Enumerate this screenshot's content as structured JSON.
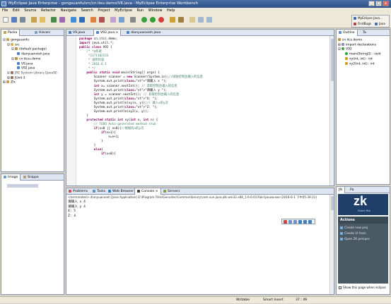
{
  "window": {
    "title": "MyEclipse Java Enterprise - gongsuanfu/src/cn.lieu.demo/V8.java - MyEclipse Enterprise Workbench"
  },
  "menu": [
    "File",
    "Edit",
    "Source",
    "Refactor",
    "Navigate",
    "Search",
    "Project",
    "MyEclipse",
    "Run",
    "Window",
    "Help"
  ],
  "perspectives": {
    "myeclipse": "MyEclipse Java...",
    "pindbugs": "FindBugs",
    "java": "Java"
  },
  "left_panel": {
    "tabs": [
      "Packa",
      "Hierarc"
    ],
    "tree": [
      "gongsuanfu",
      "src",
      "(default package)",
      "dianyuanxieh.java",
      "cn.itcss.demo",
      "V9.java",
      "V92.java",
      "JRE System Library [JavaSE-",
      "JUnit 3",
      "Zlx"
    ]
  },
  "bottom_left": {
    "tabs": [
      "Image",
      "Snippe"
    ]
  },
  "editor": {
    "tabs": [
      "V9.java",
      "V92.java",
      "dianyuanxieh.java"
    ],
    "lines": [
      "package cn.itcs.demo;",
      "import java.util.*;",
      "public class V92 {",
      "    /* *@作者",
      "     *1171102233",
      "     * 说明内容",
      "     * 2016.6.1",
      "     * */",
      "    public static void main(String[] args) {",
      "        Scanner scanner = new Scanner(System.in);//接收控制台输入的信息",
      "        System.out.print(\"请输入 x \");",
      "        int x= scanner.nextInt(); // 获取控制台输入的信息",
      "        System.out.print(\"请输入 y \");",
      "        int y = scanner.nextInt(); // 获取控制台输入的信息",
      "        System.out.print(\"X: \");",
      "        System.out.println(xy(x, y));// 输入x的y次",
      "        System.out.print(\"Z: \");",
      "        System.out.println(xy2(x, y));",
      "    }",
      "    protected static int xy(int x, int n) {",
      "        // TODO Auto-generated method stub",
      "        if(x<0 || n<0){//根据有x的y次",
      "            if(n>1){",
      "                n=n+1;",
      "            }",
      "        }",
      "        else{",
      "            if(x<0){"
    ]
  },
  "outline": {
    "tabs": [
      "Outline",
      "Ta"
    ],
    "items": [
      "cn.itcs.demo",
      "import declarations",
      "V92",
      "main(String[]) : void",
      "xy(int, int) : int",
      "xy2(int, int) : int"
    ]
  },
  "console": {
    "tabs": [
      "Problems",
      "Tasks",
      "Web Browser",
      "Console",
      "Servers"
    ],
    "header": "<terminated> dianyuanxieh [Java Application] E:\\Program Files\\Genuitec\\Common\\binary\\com.sun.java.jdk.win32.x86_1.6.0.013\\bin\\javaw.exe (2016-6-1 下午05:39:21)",
    "lines": [
      "请输入 x  4",
      "请输入 y  4",
      "X: 5",
      "Z: 4"
    ]
  },
  "right_bottom": {
    "tabs": [
      "JN",
      "Pa"
    ],
    "brand": "zk",
    "brand_sub": "Direct RIA",
    "actions_title": "Actions",
    "actions": [
      "Create new proj",
      "Create UI from",
      "Open ZK perspec"
    ],
    "show_checkbox": "Show this page when eclipse"
  },
  "status": {
    "writable": "Writable",
    "insert": "Smart Insert",
    "position": "37 : 49"
  },
  "colors": {
    "accent": "#2d4f86",
    "keyword": "#7f0055",
    "comment": "#3f7f5f",
    "string": "#2a00ff"
  }
}
